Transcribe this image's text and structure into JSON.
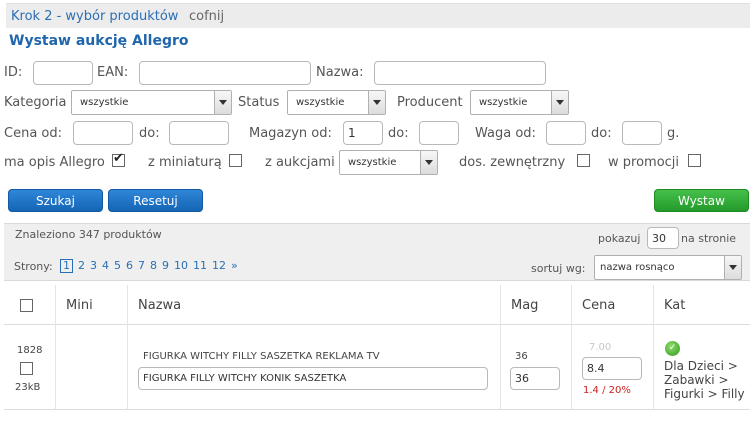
{
  "breadcrumb": {
    "step": "Krok 2 - wybór produktów",
    "back": "cofnij"
  },
  "page_title": "Wystaw aukcję Allegro",
  "filters": {
    "id_label": "ID:",
    "id_value": "",
    "ean_label": "EAN:",
    "ean_value": "",
    "name_label": "Nazwa:",
    "name_value": "",
    "category_label": "Kategoria",
    "category_value": "wszystkie",
    "status_label": "Status",
    "status_value": "wszystkie",
    "producer_label": "Producent",
    "producer_value": "wszystkie",
    "price_from_label": "Cena od:",
    "price_from_value": "",
    "price_to_label": "do:",
    "price_to_value": "",
    "stock_from_label": "Magazyn od:",
    "stock_from_value": "1",
    "stock_to_label": "do:",
    "stock_to_value": "",
    "weight_from_label": "Waga od:",
    "weight_from_value": "",
    "weight_to_label": "do:",
    "weight_to_value": "",
    "weight_unit": "g.",
    "has_allegro_desc_label": "ma opis Allegro",
    "has_allegro_desc_checked": true,
    "with_thumb_label": "z miniaturą",
    "with_thumb_checked": false,
    "with_auctions_label": "z aukcjami",
    "with_auctions_value": "wszystkie",
    "external_label": "dos. zewnętrzny",
    "external_checked": false,
    "promo_label": "w promocji",
    "promo_checked": false
  },
  "buttons": {
    "search": "Szukaj",
    "reset": "Resetuj",
    "publish": "Wystaw"
  },
  "results": {
    "found_text": "Znaleziono 347 produktów",
    "show_label": "pokazuj",
    "show_value": "30",
    "per_page_label": "na stronie",
    "pages_label": "Strony:",
    "pages": [
      "1",
      "2",
      "3",
      "4",
      "5",
      "6",
      "7",
      "8",
      "9",
      "10",
      "11",
      "12"
    ],
    "next_symbol": "»",
    "sort_label": "sortuj wg:",
    "sort_value": "nazwa rosnąco"
  },
  "table": {
    "headers": {
      "mini": "Mini",
      "name": "Nazwa",
      "stock": "Mag",
      "price": "Cena",
      "category": "Kat"
    },
    "rows": [
      {
        "id": "1828",
        "size": "23kB",
        "original_name": "FIGURKA WITCHY FILLY SASZETKA REKLAMA TV",
        "auction_name": "FIGURKA FILLY WITCHY KONIK SASZETKA",
        "stock": "36",
        "stock_input": "36",
        "price_old": "7.00",
        "price_input": "8.4",
        "price_diff": "1.4 / 20%",
        "category_path": [
          "Dla Dzieci >",
          "Zabawki >",
          "Figurki > Filly"
        ],
        "category_icon": "check-circle-icon"
      }
    ]
  }
}
